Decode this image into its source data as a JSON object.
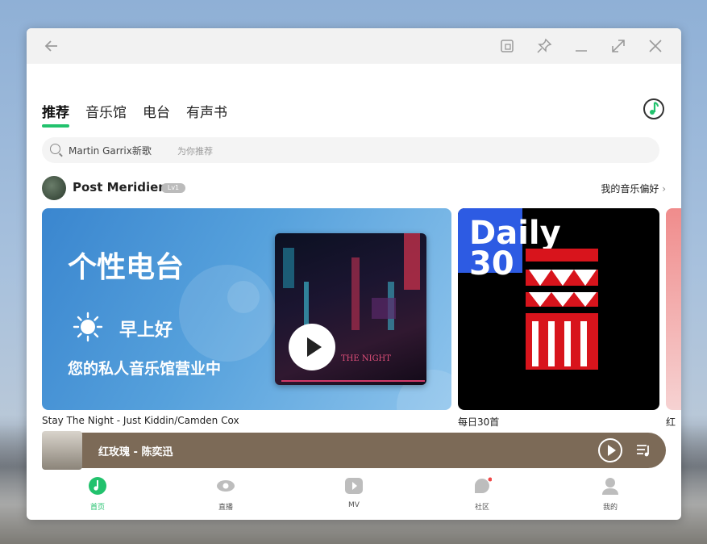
{
  "window": {
    "back_icon": "back-arrow-icon",
    "toolbar_icons": [
      "mini-mode-icon",
      "pin-icon",
      "minimize-icon",
      "maximize-icon",
      "close-icon"
    ]
  },
  "tabs": [
    {
      "label": "推荐",
      "active": true
    },
    {
      "label": "音乐馆",
      "active": false
    },
    {
      "label": "电台",
      "active": false
    },
    {
      "label": "有声书",
      "active": false
    }
  ],
  "search": {
    "query": "Martin Garrix新歌",
    "hint": "为你推荐"
  },
  "user": {
    "name": "Post Meridiem",
    "level_badge": "Lv1",
    "pref_link": "我的音乐偏好"
  },
  "cards": [
    {
      "title": "个性电台",
      "greeting": "早上好",
      "subtitle": "您的私人音乐馆营业中",
      "album_text": "THE NIGHT",
      "caption": "Stay The Night - Just Kiddin/Camden Cox"
    },
    {
      "title_line1": "Daily",
      "title_line2": "30",
      "caption": "每日30首"
    },
    {
      "caption": "红"
    }
  ],
  "player": {
    "song": "红玫瑰 - 陈奕迅"
  },
  "bottom_nav": [
    {
      "label": "首页",
      "active": true
    },
    {
      "label": "直播",
      "active": false
    },
    {
      "label": "MV",
      "active": false
    },
    {
      "label": "社区",
      "active": false
    },
    {
      "label": "我的",
      "active": false
    }
  ],
  "colors": {
    "accent": "#22c26d",
    "player_bg": "#7c6a57",
    "daily_blue": "#2d5be3",
    "daily_red": "#d8141c"
  }
}
